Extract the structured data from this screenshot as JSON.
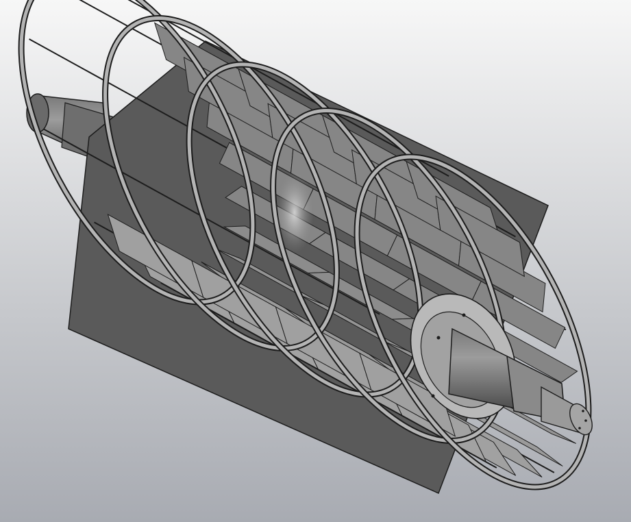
{
  "scene": {
    "subject": "rotor-assembly",
    "background_top": "#f7f7f7",
    "background_bottom": "#a8abb2",
    "metal_light": "#b4b4b4",
    "metal_mid": "#8a8a8a",
    "metal_dark": "#4e4e4e",
    "edge": "#1c1c1c",
    "highlight": "#dcdcdc",
    "ring_count": 5,
    "blades_per_ring": 22
  }
}
